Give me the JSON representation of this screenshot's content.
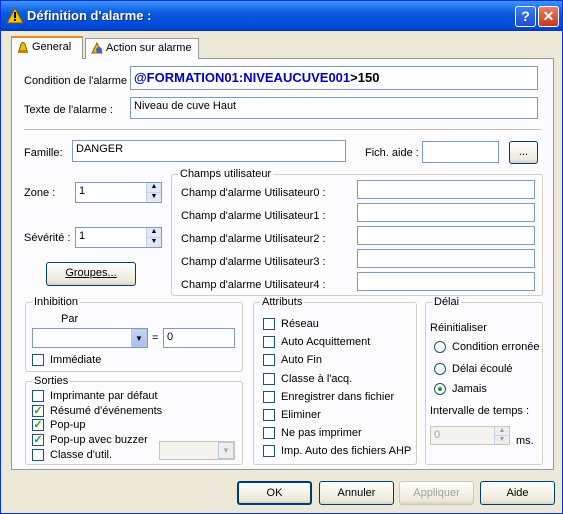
{
  "window": {
    "title": "Définition d'alarme :",
    "help_label": "?",
    "close_label": "✕"
  },
  "tabs": [
    {
      "label": "General"
    },
    {
      "label": "Action sur alarme"
    }
  ],
  "condition": {
    "label": "Condition de l'alarme :",
    "value_tag": "@FORMATION01:NIVEAUCUVE001",
    "value_rest": ">150"
  },
  "texte": {
    "label": "Texte de l'alarme :",
    "value": "Niveau de cuve Haut"
  },
  "famille": {
    "label": "Famille:",
    "value": "DANGER"
  },
  "fich_aide": {
    "label": "Fich. aide :",
    "value": "",
    "browse_label": "..."
  },
  "zone": {
    "label": "Zone :",
    "value": "1"
  },
  "severite": {
    "label": "Sévérité :",
    "value": "1"
  },
  "groupes_label": "Groupes...",
  "champs": {
    "title": "Champs utilisateur",
    "items": [
      {
        "label": "Champ d'alarme Utilisateur0 :",
        "value": ""
      },
      {
        "label": "Champ d'alarme Utilisateur1 :",
        "value": ""
      },
      {
        "label": "Champ d'alarme Utilisateur2 :",
        "value": ""
      },
      {
        "label": "Champ d'alarme Utilisateur3 :",
        "value": ""
      },
      {
        "label": "Champ d'alarme Utilisateur4 :",
        "value": ""
      }
    ]
  },
  "inhibition": {
    "title": "Inhibition",
    "par_label": "Par",
    "combo_value": "",
    "eq_label": "=",
    "eq_value": "0",
    "immediate_label": "Immédiate",
    "immediate_checked": false
  },
  "sorties": {
    "title": "Sorties",
    "items": [
      {
        "label": "Imprimante par défaut",
        "checked": false
      },
      {
        "label": "Résumé d'événements",
        "checked": true
      },
      {
        "label": "Pop-up",
        "checked": true
      },
      {
        "label": "Pop-up avec buzzer",
        "checked": true
      },
      {
        "label": "Classe d'util.",
        "checked": false
      }
    ],
    "classe_combo": ""
  },
  "attributs": {
    "title": "Attributs",
    "items": [
      {
        "label": "Réseau",
        "checked": false
      },
      {
        "label": "Auto Acquittement",
        "checked": false
      },
      {
        "label": "Auto Fin",
        "checked": false
      },
      {
        "label": "Classe à l'acq.",
        "checked": false
      },
      {
        "label": "Enregistrer dans fichier",
        "checked": false
      },
      {
        "label": "Eliminer",
        "checked": false
      },
      {
        "label": "Ne pas imprimer",
        "checked": false
      },
      {
        "label": "Imp. Auto des fichiers AHP",
        "checked": false
      }
    ]
  },
  "delai": {
    "title": "Délai",
    "reinit_label": "Réinitialiser",
    "options": [
      {
        "label": "Condition erronée",
        "selected": false
      },
      {
        "label": "Délai écoulé",
        "selected": false
      },
      {
        "label": "Jamais",
        "selected": true
      }
    ],
    "intervalle_label": "Intervalle de temps :",
    "intervalle_value": "0",
    "unit": "ms."
  },
  "buttons": {
    "ok": "OK",
    "annuler": "Annuler",
    "appliquer": "Appliquer",
    "aide": "Aide"
  },
  "colors": {
    "title_bar": "#0a5ae0",
    "condition_text": "#0000c0",
    "check_mark": "#21a121"
  }
}
